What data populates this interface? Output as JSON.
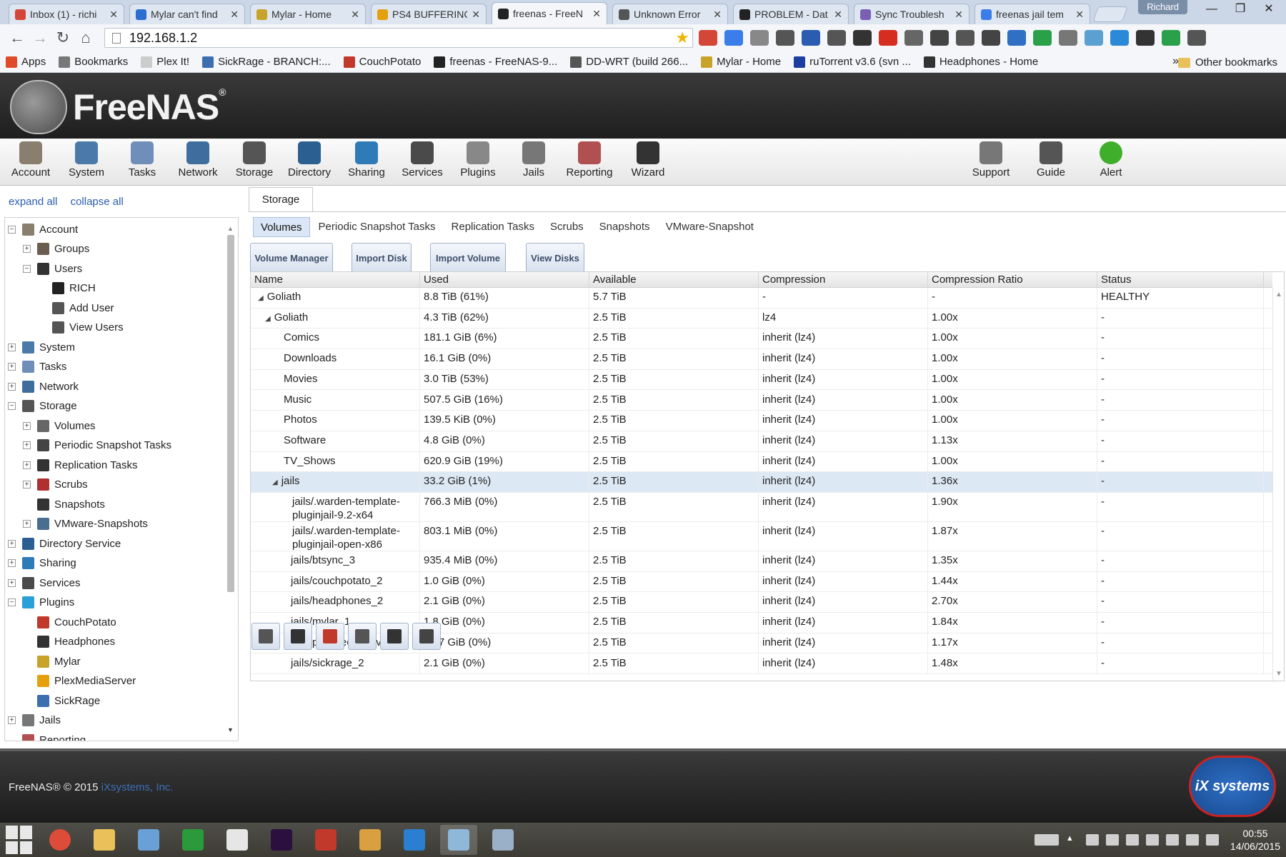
{
  "browser": {
    "tabs": [
      {
        "label": "Inbox (1) - richi",
        "icon_color": "#d44638",
        "icon": "gmail-icon"
      },
      {
        "label": "Mylar can't find",
        "icon_color": "#2d6fd1",
        "icon": "chrome-page-icon"
      },
      {
        "label": "Mylar - Home",
        "icon_color": "#c8a32b",
        "icon": "mylar-icon"
      },
      {
        "label": "PS4 BUFFERING",
        "icon_color": "#e5a00d",
        "icon": "plex-icon"
      },
      {
        "label": "freenas - FreeN",
        "icon_color": "#222222",
        "icon": "freenas-icon",
        "active": true
      },
      {
        "label": "Unknown Error",
        "icon_color": "#555555",
        "icon": "globe-icon"
      },
      {
        "label": "PROBLEM - Dat",
        "icon_color": "#222222",
        "icon": "freenas-icon"
      },
      {
        "label": "Sync Troublesh",
        "icon_color": "#7a5fb5",
        "icon": "btsync-icon"
      },
      {
        "label": "freenas jail tem",
        "icon_color": "#3b7de9",
        "icon": "google-icon"
      }
    ],
    "profile": "Richard",
    "address": "192.168.1.2",
    "bookmarks": [
      {
        "label": "Apps",
        "icon": "apps-icon",
        "color": "#e04b2c"
      },
      {
        "label": "Bookmarks",
        "icon": "star-icon",
        "color": "#777777"
      },
      {
        "label": "Plex It!",
        "icon": "page-icon",
        "color": "#cccccc"
      },
      {
        "label": "SickRage - BRANCH:...",
        "icon": "sickrage-icon",
        "color": "#3c6fb0"
      },
      {
        "label": "CouchPotato",
        "icon": "couchpotato-icon",
        "color": "#c0392b"
      },
      {
        "label": "freenas - FreeNAS-9...",
        "icon": "freenas-icon",
        "color": "#222222"
      },
      {
        "label": "DD-WRT (build 266...",
        "icon": "ddwrt-icon",
        "color": "#555555"
      },
      {
        "label": "Mylar - Home",
        "icon": "mylar-icon",
        "color": "#c8a32b"
      },
      {
        "label": "ruTorrent v3.6 (svn ...",
        "icon": "rutorrent-icon",
        "color": "#1b3fa0"
      },
      {
        "label": "Headphones - Home",
        "icon": "headphones-icon",
        "color": "#333333"
      }
    ],
    "more_bookmarks": "»",
    "other_bookmarks": "Other bookmarks"
  },
  "freenas": {
    "logo_text": "FreeNAS",
    "logo_reg": "®",
    "toolbar": [
      {
        "label": "Account",
        "icon": "account-icon",
        "color": "#8a7f6e"
      },
      {
        "label": "System",
        "icon": "system-icon",
        "color": "#4c7aa8"
      },
      {
        "label": "Tasks",
        "icon": "tasks-icon",
        "color": "#6f8fb8"
      },
      {
        "label": "Network",
        "icon": "network-icon",
        "color": "#3f6e9e"
      },
      {
        "label": "Storage",
        "icon": "storage-icon",
        "color": "#555555"
      },
      {
        "label": "Directory",
        "icon": "directory-icon",
        "color": "#2b5f91"
      },
      {
        "label": "Sharing",
        "icon": "sharing-icon",
        "color": "#2f7bb8"
      },
      {
        "label": "Services",
        "icon": "services-icon",
        "color": "#4a4a4a"
      },
      {
        "label": "Plugins",
        "icon": "plugins-icon",
        "color": "#888888"
      },
      {
        "label": "Jails",
        "icon": "jails-icon",
        "color": "#777777"
      },
      {
        "label": "Reporting",
        "icon": "reporting-icon",
        "color": "#b05050"
      },
      {
        "label": "Wizard",
        "icon": "wizard-icon",
        "color": "#333333"
      }
    ],
    "toolbar_right": [
      {
        "label": "Support",
        "icon": "support-icon",
        "color": "#777777"
      },
      {
        "label": "Guide",
        "icon": "guide-icon",
        "color": "#555555"
      },
      {
        "label": "Alert",
        "icon": "alert-icon",
        "color": "#3fae2a"
      }
    ],
    "expand_all": "expand all",
    "collapse_all": "collapse all",
    "tree": [
      {
        "label": "Account",
        "level": 0,
        "toggle": "−",
        "icon": "account-icon",
        "color": "#8a7f6e"
      },
      {
        "label": "Groups",
        "level": 1,
        "toggle": "+",
        "icon": "groups-icon",
        "color": "#6b5d4f"
      },
      {
        "label": "Users",
        "level": 1,
        "toggle": "−",
        "icon": "user-icon",
        "color": "#333333"
      },
      {
        "label": "RICH",
        "level": 2,
        "toggle": "",
        "icon": "user-icon",
        "color": "#222222"
      },
      {
        "label": "Add User",
        "level": 2,
        "toggle": "",
        "icon": "add-user-icon",
        "color": "#555555"
      },
      {
        "label": "View Users",
        "level": 2,
        "toggle": "",
        "icon": "view-users-icon",
        "color": "#555555"
      },
      {
        "label": "System",
        "level": 0,
        "toggle": "+",
        "icon": "system-icon",
        "color": "#4c7aa8"
      },
      {
        "label": "Tasks",
        "level": 0,
        "toggle": "+",
        "icon": "tasks-icon",
        "color": "#6f8fb8"
      },
      {
        "label": "Network",
        "level": 0,
        "toggle": "+",
        "icon": "network-icon",
        "color": "#3f6e9e"
      },
      {
        "label": "Storage",
        "level": 0,
        "toggle": "−",
        "icon": "storage-icon",
        "color": "#555555"
      },
      {
        "label": "Volumes",
        "level": 1,
        "toggle": "+",
        "icon": "volumes-icon",
        "color": "#666666"
      },
      {
        "label": "Periodic Snapshot Tasks",
        "level": 1,
        "toggle": "+",
        "icon": "snapshot-tasks-icon",
        "color": "#444444"
      },
      {
        "label": "Replication Tasks",
        "level": 1,
        "toggle": "+",
        "icon": "replication-icon",
        "color": "#333333"
      },
      {
        "label": "Scrubs",
        "level": 1,
        "toggle": "+",
        "icon": "scrubs-icon",
        "color": "#b03030"
      },
      {
        "label": "Snapshots",
        "level": 1,
        "toggle": "",
        "icon": "snapshots-icon",
        "color": "#333333"
      },
      {
        "label": "VMware-Snapshots",
        "level": 1,
        "toggle": "+",
        "icon": "vmware-icon",
        "color": "#4a6e90"
      },
      {
        "label": "Directory Service",
        "level": 0,
        "toggle": "+",
        "icon": "directory-icon",
        "color": "#2b5f91"
      },
      {
        "label": "Sharing",
        "level": 0,
        "toggle": "+",
        "icon": "sharing-icon",
        "color": "#2f7bb8"
      },
      {
        "label": "Services",
        "level": 0,
        "toggle": "+",
        "icon": "services-icon",
        "color": "#4a4a4a"
      },
      {
        "label": "Plugins",
        "level": 0,
        "toggle": "−",
        "icon": "plugins-icon",
        "color": "#2aa0d8"
      },
      {
        "label": "CouchPotato",
        "level": 1,
        "toggle": "",
        "icon": "couchpotato-icon",
        "color": "#c0392b"
      },
      {
        "label": "Headphones",
        "level": 1,
        "toggle": "",
        "icon": "headphones-icon",
        "color": "#333333"
      },
      {
        "label": "Mylar",
        "level": 1,
        "toggle": "",
        "icon": "mylar-icon",
        "color": "#c8a32b"
      },
      {
        "label": "PlexMediaServer",
        "level": 1,
        "toggle": "",
        "icon": "plex-icon",
        "color": "#e5a00d"
      },
      {
        "label": "SickRage",
        "level": 1,
        "toggle": "",
        "icon": "sickrage-icon",
        "color": "#3c6fb0"
      },
      {
        "label": "Jails",
        "level": 0,
        "toggle": "+",
        "icon": "jails-icon",
        "color": "#777777"
      },
      {
        "label": "Reporting",
        "level": 0,
        "toggle": "",
        "icon": "reporting-icon",
        "color": "#b05050"
      }
    ],
    "main_tab": "Storage",
    "subtabs": [
      "Volumes",
      "Periodic Snapshot Tasks",
      "Replication Tasks",
      "Scrubs",
      "Snapshots",
      "VMware-Snapshot"
    ],
    "volume_buttons": [
      "Volume Manager",
      "Import Disk",
      "Import Volume",
      "View Disks"
    ],
    "columns": [
      "Name",
      "Used",
      "Available",
      "Compression",
      "Compression Ratio",
      "Status"
    ],
    "rows": [
      {
        "name": "Goliath",
        "indent": 0,
        "expander": "◢",
        "used": "8.8 TiB (61%)",
        "available": "5.7 TiB",
        "compression": "-",
        "ratio": "-",
        "status": "HEALTHY"
      },
      {
        "name": "Goliath",
        "indent": 1,
        "expander": "◢",
        "used": "4.3 TiB (62%)",
        "available": "2.5 TiB",
        "compression": "lz4",
        "ratio": "1.00x",
        "status": "-"
      },
      {
        "name": "Comics",
        "indent": 2,
        "expander": "",
        "used": "181.1 GiB (6%)",
        "available": "2.5 TiB",
        "compression": "inherit (lz4)",
        "ratio": "1.00x",
        "status": "-"
      },
      {
        "name": "Downloads",
        "indent": 2,
        "expander": "",
        "used": "16.1 GiB (0%)",
        "available": "2.5 TiB",
        "compression": "inherit (lz4)",
        "ratio": "1.00x",
        "status": "-"
      },
      {
        "name": "Movies",
        "indent": 2,
        "expander": "",
        "used": "3.0 TiB (53%)",
        "available": "2.5 TiB",
        "compression": "inherit (lz4)",
        "ratio": "1.00x",
        "status": "-"
      },
      {
        "name": "Music",
        "indent": 2,
        "expander": "",
        "used": "507.5 GiB (16%)",
        "available": "2.5 TiB",
        "compression": "inherit (lz4)",
        "ratio": "1.00x",
        "status": "-"
      },
      {
        "name": "Photos",
        "indent": 2,
        "expander": "",
        "used": "139.5 KiB (0%)",
        "available": "2.5 TiB",
        "compression": "inherit (lz4)",
        "ratio": "1.00x",
        "status": "-"
      },
      {
        "name": "Software",
        "indent": 2,
        "expander": "",
        "used": "4.8 GiB (0%)",
        "available": "2.5 TiB",
        "compression": "inherit (lz4)",
        "ratio": "1.13x",
        "status": "-"
      },
      {
        "name": "TV_Shows",
        "indent": 2,
        "expander": "",
        "used": "620.9 GiB (19%)",
        "available": "2.5 TiB",
        "compression": "inherit (lz4)",
        "ratio": "1.00x",
        "status": "-"
      },
      {
        "name": "jails",
        "indent": 2,
        "expander": "◢",
        "used": "33.2 GiB (1%)",
        "available": "2.5 TiB",
        "compression": "inherit (lz4)",
        "ratio": "1.36x",
        "status": "-",
        "selected": true
      },
      {
        "name": "jails/.warden-template-pluginjail-9.2-x64",
        "indent": 3,
        "expander": "",
        "used": "766.3 MiB (0%)",
        "available": "2.5 TiB",
        "compression": "inherit (lz4)",
        "ratio": "1.90x",
        "status": "-",
        "tall": true
      },
      {
        "name": "jails/.warden-template-pluginjail-open-x86",
        "indent": 3,
        "expander": "",
        "used": "803.1 MiB (0%)",
        "available": "2.5 TiB",
        "compression": "inherit (lz4)",
        "ratio": "1.87x",
        "status": "-",
        "tall": true
      },
      {
        "name": "jails/btsync_3",
        "indent": 3,
        "expander": "",
        "used": "935.4 MiB (0%)",
        "available": "2.5 TiB",
        "compression": "inherit (lz4)",
        "ratio": "1.35x",
        "status": "-"
      },
      {
        "name": "jails/couchpotato_2",
        "indent": 3,
        "expander": "",
        "used": "1.0 GiB (0%)",
        "available": "2.5 TiB",
        "compression": "inherit (lz4)",
        "ratio": "1.44x",
        "status": "-"
      },
      {
        "name": "jails/headphones_2",
        "indent": 3,
        "expander": "",
        "used": "2.1 GiB (0%)",
        "available": "2.5 TiB",
        "compression": "inherit (lz4)",
        "ratio": "2.70x",
        "status": "-"
      },
      {
        "name": "jails/mylar_1",
        "indent": 3,
        "expander": "",
        "used": "1.8 GiB (0%)",
        "available": "2.5 TiB",
        "compression": "inherit (lz4)",
        "ratio": "1.84x",
        "status": "-"
      },
      {
        "name": "jails/plexmediaserver_2",
        "indent": 3,
        "expander": "",
        "used": "23.7 GiB (0%)",
        "available": "2.5 TiB",
        "compression": "inherit (lz4)",
        "ratio": "1.17x",
        "status": "-"
      },
      {
        "name": "jails/sickrage_2",
        "indent": 3,
        "expander": "",
        "used": "2.1 GiB (0%)",
        "available": "2.5 TiB",
        "compression": "inherit (lz4)",
        "ratio": "1.48x",
        "status": "-"
      }
    ],
    "action_buttons": [
      {
        "name": "change-permissions-button",
        "icon": "permissions-icon",
        "color": "#555555"
      },
      {
        "name": "create-dataset-button",
        "icon": "create-dataset-icon",
        "color": "#333333"
      },
      {
        "name": "destroy-dataset-button",
        "icon": "destroy-icon",
        "color": "#c0392b"
      },
      {
        "name": "edit-options-button",
        "icon": "wrench-icon",
        "color": "#555555"
      },
      {
        "name": "create-zvol-button",
        "icon": "zvol-icon",
        "color": "#333333"
      },
      {
        "name": "create-snapshot-button",
        "icon": "snapshot-icon",
        "color": "#444444"
      }
    ],
    "footer_copy": "FreeNAS® © 2015",
    "footer_link": "iXsystems, Inc.",
    "footer_logo": "iX systems"
  },
  "taskbar": {
    "apps": [
      {
        "name": "chrome",
        "color": "#dd4b39",
        "icon": "chrome-icon"
      },
      {
        "name": "explorer",
        "color": "#e8c15a",
        "icon": "folder-icon"
      },
      {
        "name": "rdp",
        "color": "#6aa0d8",
        "icon": "remote-desktop-icon"
      },
      {
        "name": "store",
        "color": "#2b9a3a",
        "icon": "store-icon"
      },
      {
        "name": "apps",
        "color": "#e6e6e6",
        "icon": "apps-grid-icon"
      },
      {
        "name": "premiere",
        "color": "#2a0f3f",
        "icon": "premiere-icon"
      },
      {
        "name": "filezilla",
        "color": "#c0392b",
        "icon": "filezilla-icon"
      },
      {
        "name": "keys",
        "color": "#d8a040",
        "icon": "keys-icon"
      },
      {
        "name": "feather",
        "color": "#2a7fd0",
        "icon": "feather-icon"
      },
      {
        "name": "notes",
        "color": "#8fb8d8",
        "icon": "notes-icon"
      },
      {
        "name": "control",
        "color": "#9ab0c8",
        "icon": "control-panel-icon"
      }
    ],
    "time": "00:55",
    "date": "14/06/2015"
  }
}
